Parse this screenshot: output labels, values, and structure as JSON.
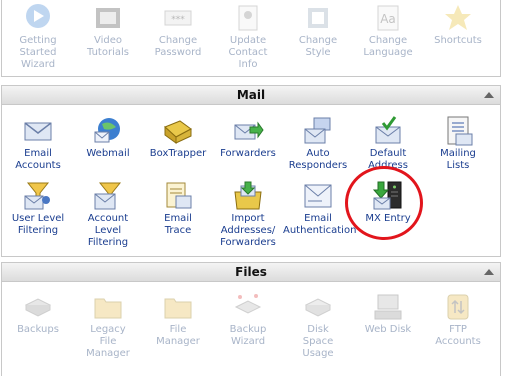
{
  "preferences": {
    "items": [
      {
        "label": "Getting\nStarted\nWizard",
        "icon": "wizard-icon"
      },
      {
        "label": "Video\nTutorials",
        "icon": "video-icon"
      },
      {
        "label": "Change\nPassword",
        "icon": "password-icon"
      },
      {
        "label": "Update\nContact\nInfo",
        "icon": "contact-icon"
      },
      {
        "label": "Change\nStyle",
        "icon": "style-icon"
      },
      {
        "label": "Change\nLanguage",
        "icon": "language-icon"
      },
      {
        "label": "Shortcuts",
        "icon": "star-icon"
      }
    ]
  },
  "mail": {
    "title": "Mail",
    "row1": [
      {
        "label": "Email\nAccounts",
        "icon": "envelope-icon"
      },
      {
        "label": "Webmail",
        "icon": "webmail-icon"
      },
      {
        "label": "BoxTrapper",
        "icon": "boxtrapper-icon"
      },
      {
        "label": "Forwarders",
        "icon": "forward-icon"
      },
      {
        "label": "Auto\nResponders",
        "icon": "autoresponder-icon"
      },
      {
        "label": "Default\nAddress",
        "icon": "default-address-icon"
      },
      {
        "label": "Mailing\nLists",
        "icon": "mailing-list-icon"
      }
    ],
    "row2": [
      {
        "label": "User Level\nFiltering",
        "icon": "user-filter-icon"
      },
      {
        "label": "Account\nLevel\nFiltering",
        "icon": "account-filter-icon"
      },
      {
        "label": "Email\nTrace",
        "icon": "trace-icon"
      },
      {
        "label": "Import\nAddresses/\nForwarders",
        "icon": "import-icon"
      },
      {
        "label": "Email\nAuthentication",
        "icon": "authentication-icon"
      },
      {
        "label": "MX Entry",
        "icon": "mx-entry-icon"
      }
    ]
  },
  "files": {
    "title": "Files",
    "items": [
      {
        "label": "Backups",
        "icon": "backup-icon"
      },
      {
        "label": "Legacy\nFile\nManager",
        "icon": "folder-icon"
      },
      {
        "label": "File\nManager",
        "icon": "folder-icon"
      },
      {
        "label": "Backup\nWizard",
        "icon": "backup-wizard-icon"
      },
      {
        "label": "Disk\nSpace\nUsage",
        "icon": "disk-icon"
      },
      {
        "label": "Web Disk",
        "icon": "web-disk-icon"
      },
      {
        "label": "FTP\nAccounts",
        "icon": "ftp-icon"
      }
    ]
  },
  "colors": {
    "link": "#1a3d8f",
    "highlight": "#e2151c"
  }
}
